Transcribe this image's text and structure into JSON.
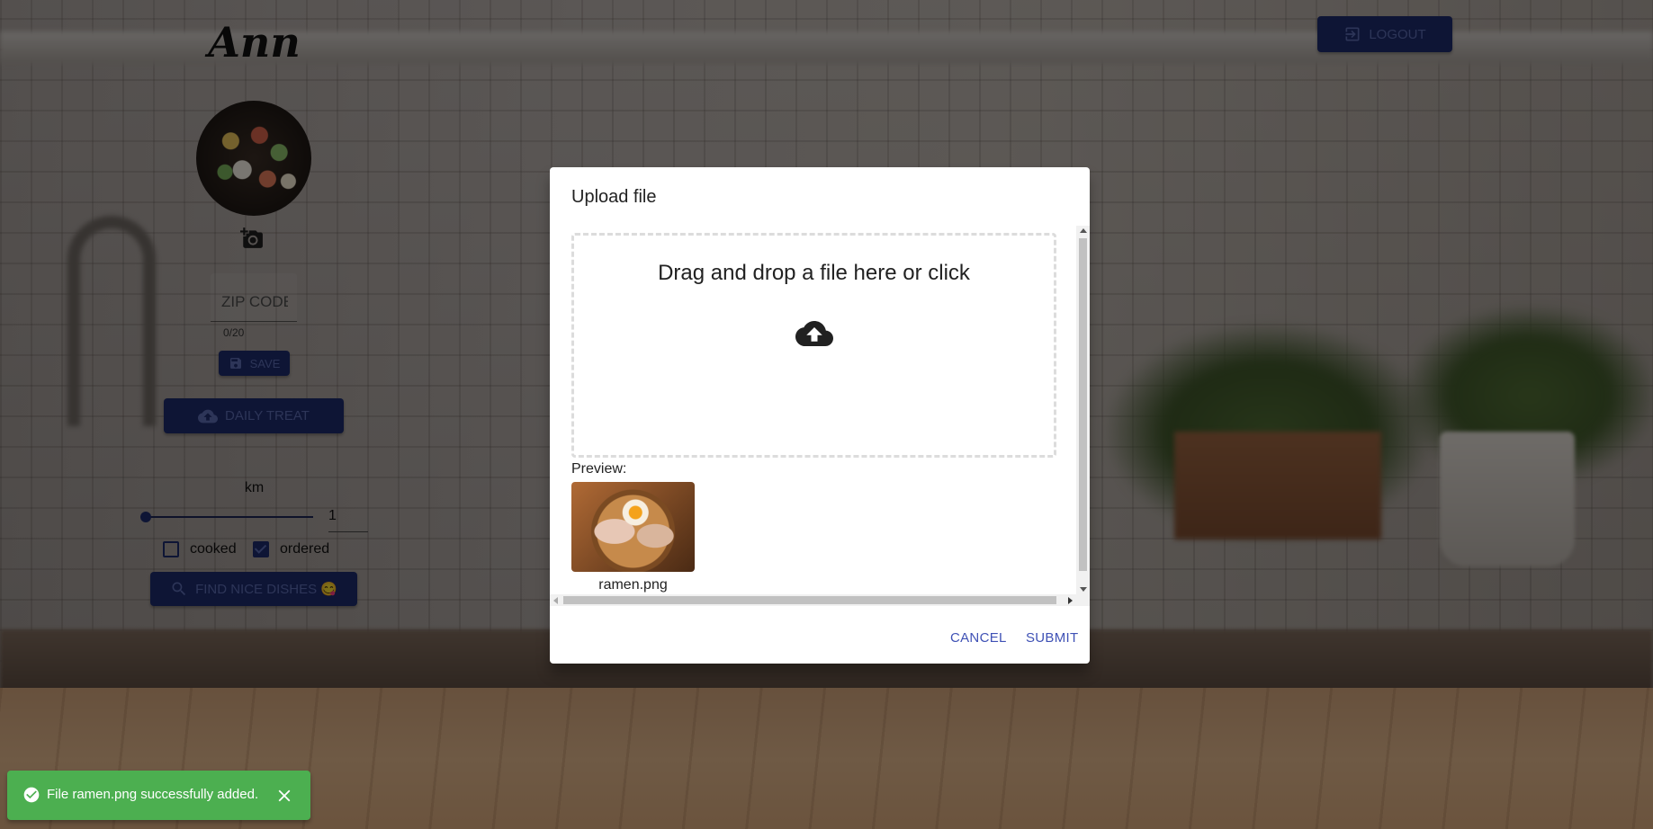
{
  "user": {
    "name": "Ann"
  },
  "zip": {
    "placeholder": "ZIP CODE",
    "value": "",
    "counter": "0/20"
  },
  "buttons": {
    "save": "Save",
    "daily_treat": "Daily treat",
    "find": "Find nice dishes 😋",
    "logout": "Logout"
  },
  "distance": {
    "unit": "km",
    "value": "1",
    "slider_fraction": 0
  },
  "filters": [
    {
      "label": "cooked",
      "checked": false
    },
    {
      "label": "ordered",
      "checked": true
    }
  ],
  "dialog": {
    "title": "Upload file",
    "dropzone_text": "Drag and drop a file here or click",
    "preview_label": "Preview:",
    "file_name": "ramen.png",
    "cancel": "Cancel",
    "submit": "Submit"
  },
  "snackbar": {
    "message": "File ramen.png successfully added."
  },
  "colors": {
    "primary": "#3f51b5",
    "primary_dim": "#1c2a6b",
    "success": "#4caf50"
  },
  "icons": {
    "add_photo": "add-a-photo-icon",
    "save": "save-icon",
    "upload": "cloud-upload-icon",
    "search": "search-icon",
    "logout": "logout-icon",
    "success": "check-circle-icon",
    "close": "close-icon"
  }
}
